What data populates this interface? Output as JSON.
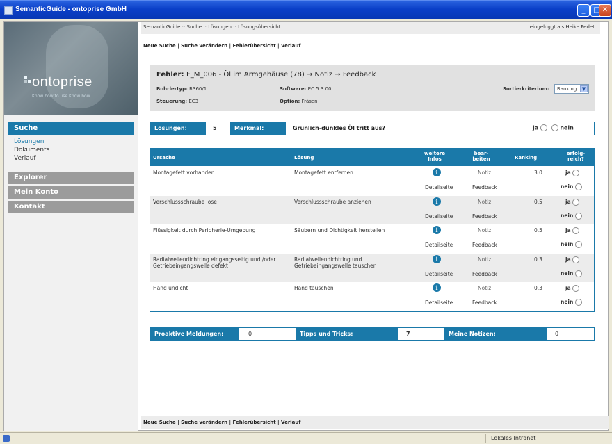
{
  "window": {
    "title": "SemanticGuide - ontoprise GmbH"
  },
  "sidebar": {
    "logo": {
      "name": "ontoprise",
      "tagline": "Know how to use Know how"
    },
    "suche": "Suche",
    "sub": [
      "Lösungen",
      "Dokuments",
      "Verlauf"
    ],
    "explorer": "Explorer",
    "konto": "Mein Konto",
    "kontakt": "Kontakt"
  },
  "breadcrumb": {
    "path": "SemanticGuide :: Suche :: Lösungen :: Lösungsübersicht",
    "login": "eingeloggt als Heike Pedet"
  },
  "toplinks": "Neue Suche | Suche verändern | Fehlerübersicht | Verlauf",
  "header": {
    "title_label": "Fehler:",
    "title_text": "F_M_006 - Öl im Armgehäuse (78) → Notiz → Feedback",
    "baureihe_label": "Bohrlertyp:",
    "baureihe_value": "R360/1",
    "steuerung_label": "Steuerung:",
    "steuerung_value": "EC3",
    "software_label": "Software:",
    "software_value": "EC 5.3.00",
    "option_label": "Option:",
    "option_value": "Fräsen",
    "sort_label": "Sortierkriterium:",
    "sort_value": "Ranking"
  },
  "question": {
    "count_label": "Lösungen:",
    "count": "5",
    "merkmal_label": "Merkmal:",
    "text": "Grünlich-dunkles Öl tritt aus?",
    "ja": "ja",
    "nein": "nein"
  },
  "table": {
    "headers": {
      "ursache": "Ursache",
      "loesung": "Lösung",
      "infos": "weitere Infos",
      "bearbeiten": "bear- beiten",
      "ranking": "Ranking",
      "erfolg": "erfolg- reich?"
    },
    "rows": [
      {
        "ursache": "Montagefett vorhanden",
        "loesung": "Montagefett entfernen",
        "ranking": "3.0"
      },
      {
        "ursache": "Verschlussschraube lose",
        "loesung": "Verschlussschraube anziehen",
        "ranking": "0.5"
      },
      {
        "ursache": "Flüssigkeit durch Peripherie-Umgebung",
        "loesung": "Säubern und Dichtigkeit herstellen",
        "ranking": "0.5"
      },
      {
        "ursache": "Radialwellendichtring eingangsseitig und /oder Getriebeingangswelle defekt",
        "loesung": "Radialwellendichtring und Getriebeingangswelle tauschen",
        "ranking": "0.3"
      },
      {
        "ursache": "Hand undicht",
        "loesung": "Hand tauschen",
        "ranking": "0.3"
      }
    ],
    "detail": "Detailseite",
    "notiz": "Notiz",
    "feedback": "Feedback",
    "ja": "ja",
    "nein": "nein",
    "info_glyph": "i"
  },
  "bottom": {
    "pro_label": "Proaktive Meldungen:",
    "pro_value": "0",
    "tipps_label": "Tipps und Tricks:",
    "tipps_value": "7",
    "notizen_label": "Meine Notizen:",
    "notizen_value": "0"
  },
  "footerlinks": "Neue Suche | Suche verändern | Fehlerübersicht | Verlauf",
  "status": {
    "zone": "Lokales Intranet"
  }
}
